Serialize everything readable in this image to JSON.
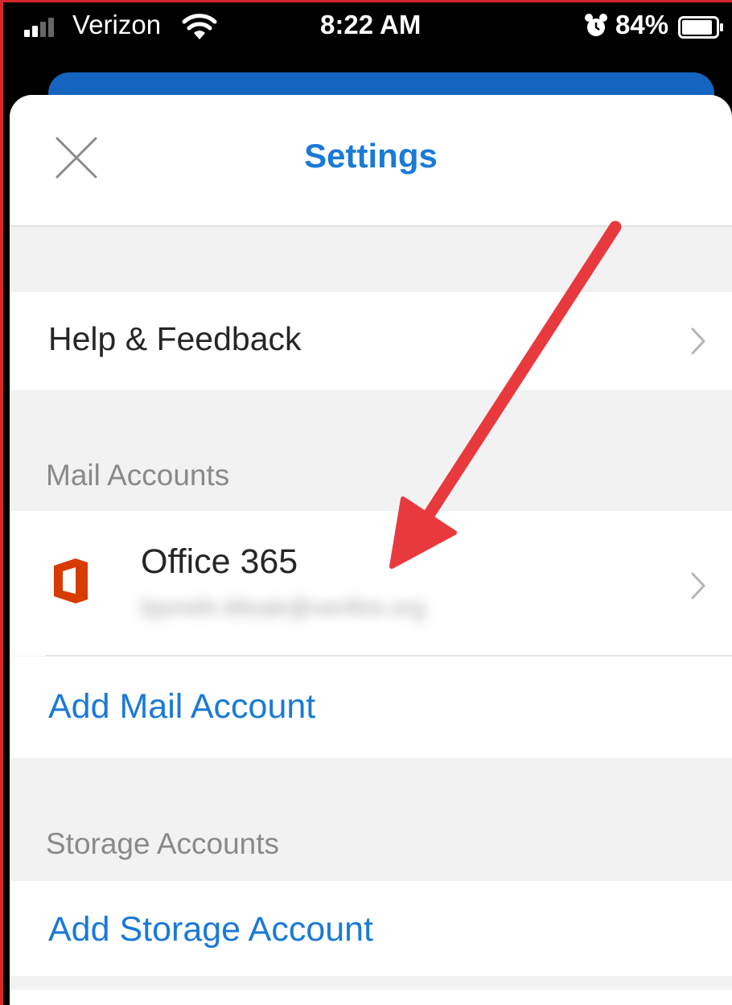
{
  "status_bar": {
    "carrier": "Verizon",
    "time": "8:22 AM",
    "battery_pct": "84%",
    "icons": [
      "signal-icon",
      "wifi-icon",
      "alarm-icon",
      "battery-icon"
    ]
  },
  "header": {
    "title": "Settings",
    "close_icon": "close-icon"
  },
  "help": {
    "label": "Help & Feedback"
  },
  "mail_accounts": {
    "section_label": "Mail Accounts",
    "account": {
      "name": "Office 365",
      "email": "bjsmith.tiltoak@verifire.org",
      "icon": "office-365-icon"
    },
    "add_label": "Add Mail Account"
  },
  "storage_accounts": {
    "section_label": "Storage Accounts",
    "add_label": "Add Storage Account"
  },
  "colors": {
    "accent": "#1a7ad6",
    "annotation_arrow": "#e8393f",
    "office_brand": "#d83b01"
  }
}
